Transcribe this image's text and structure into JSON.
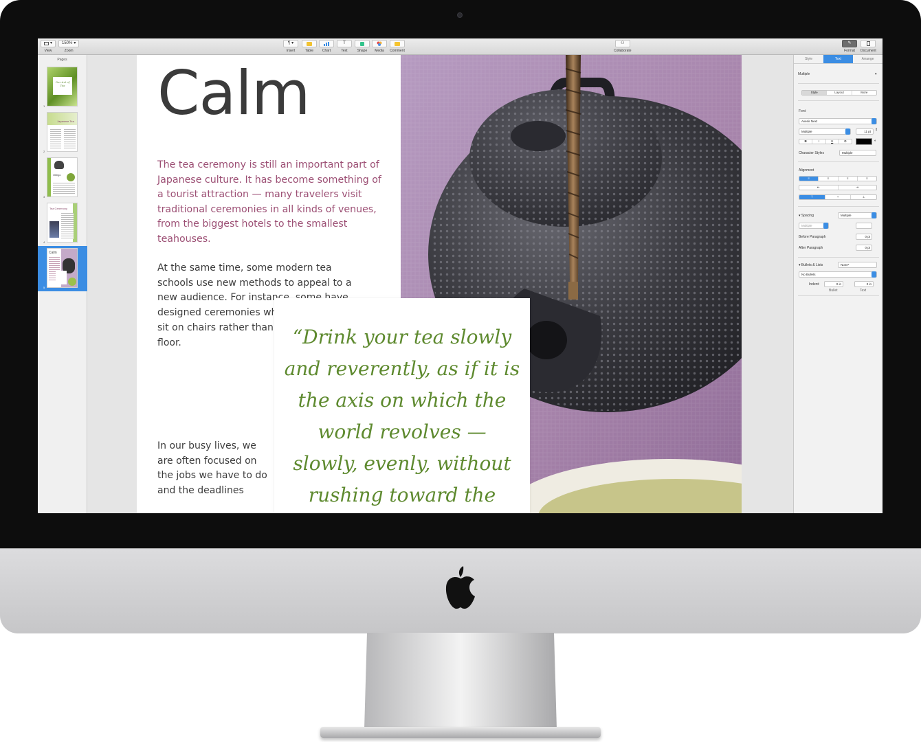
{
  "toolbar": {
    "view_label": "View",
    "zoom_value": "150%",
    "zoom_label": "Zoom",
    "insert_label": "Insert",
    "table_label": "Table",
    "chart_label": "Chart",
    "text_label": "Text",
    "shape_label": "Shape",
    "media_label": "Media",
    "comment_label": "Comment",
    "collaborate_label": "Collaborate",
    "format_label": "Format",
    "document_label": "Document"
  },
  "sidebar": {
    "title": "Pages",
    "pages": [
      {
        "number": "1",
        "caption": "Our Art of Tea"
      },
      {
        "number": "2",
        "caption": "Japanese Tea"
      },
      {
        "number": "3",
        "caption": "Obligo"
      },
      {
        "number": "4",
        "caption": "Tea Ceremony"
      },
      {
        "number": "5",
        "caption": "Calm"
      }
    ],
    "selected_index": 4
  },
  "document": {
    "title": "Calm",
    "lead": "The tea ceremony is still an important part of Japanese culture. It has become something of a tourist attraction — many travelers visit traditional ceremonies in all kinds of venues, from the biggest hotels to the smallest teahouses.",
    "body_1": "At the same time, some modern tea schools use new methods to appeal to a new audience. For instance, some have designed ceremonies where guests can sit on chairs rather than kneeling on the floor.",
    "body_2": "In our busy lives, we are often focused on the jobs we have to do and the deadlines",
    "quote": "“Drink your tea slowly and reverently, as if it is the axis on which the world revolves — slowly, evenly, without rushing toward the future.”"
  },
  "inspector": {
    "tabs": [
      "Style",
      "Text",
      "Arrange"
    ],
    "active_tab": "Text",
    "paragraph_style": "Multiple",
    "subtabs": [
      "Style",
      "Layout",
      "More"
    ],
    "font_header": "Font",
    "font_name": "Avenir Next",
    "font_style": "Multiple",
    "font_size": "11 pt",
    "format_buttons": [
      "B",
      "I",
      "U",
      "⚙"
    ],
    "char_styles_label": "Character Styles",
    "char_styles_value": "Multiple",
    "alignment_header": "Alignment",
    "spacing_label": "Spacing",
    "spacing_value": "Multiple",
    "spacing_sub": "Multiple",
    "before_label": "Before Paragraph",
    "before_value": "0 pt",
    "after_label": "After Paragraph",
    "after_value": "0 pt",
    "bullets_label": "Bullets & Lists",
    "bullets_value": "None*",
    "bullets_style": "No Bullets",
    "indent_label": "Indent:",
    "indent_bullet_value": "0 in",
    "indent_text_value": "0 in",
    "indent_bullet_caption": "Bullet",
    "indent_text_caption": "Text"
  },
  "colors": {
    "accent": "#3b8de3",
    "lead_text": "#9c4f74",
    "quote_text": "#5e8a2f",
    "title_text": "#3b3b3b"
  }
}
